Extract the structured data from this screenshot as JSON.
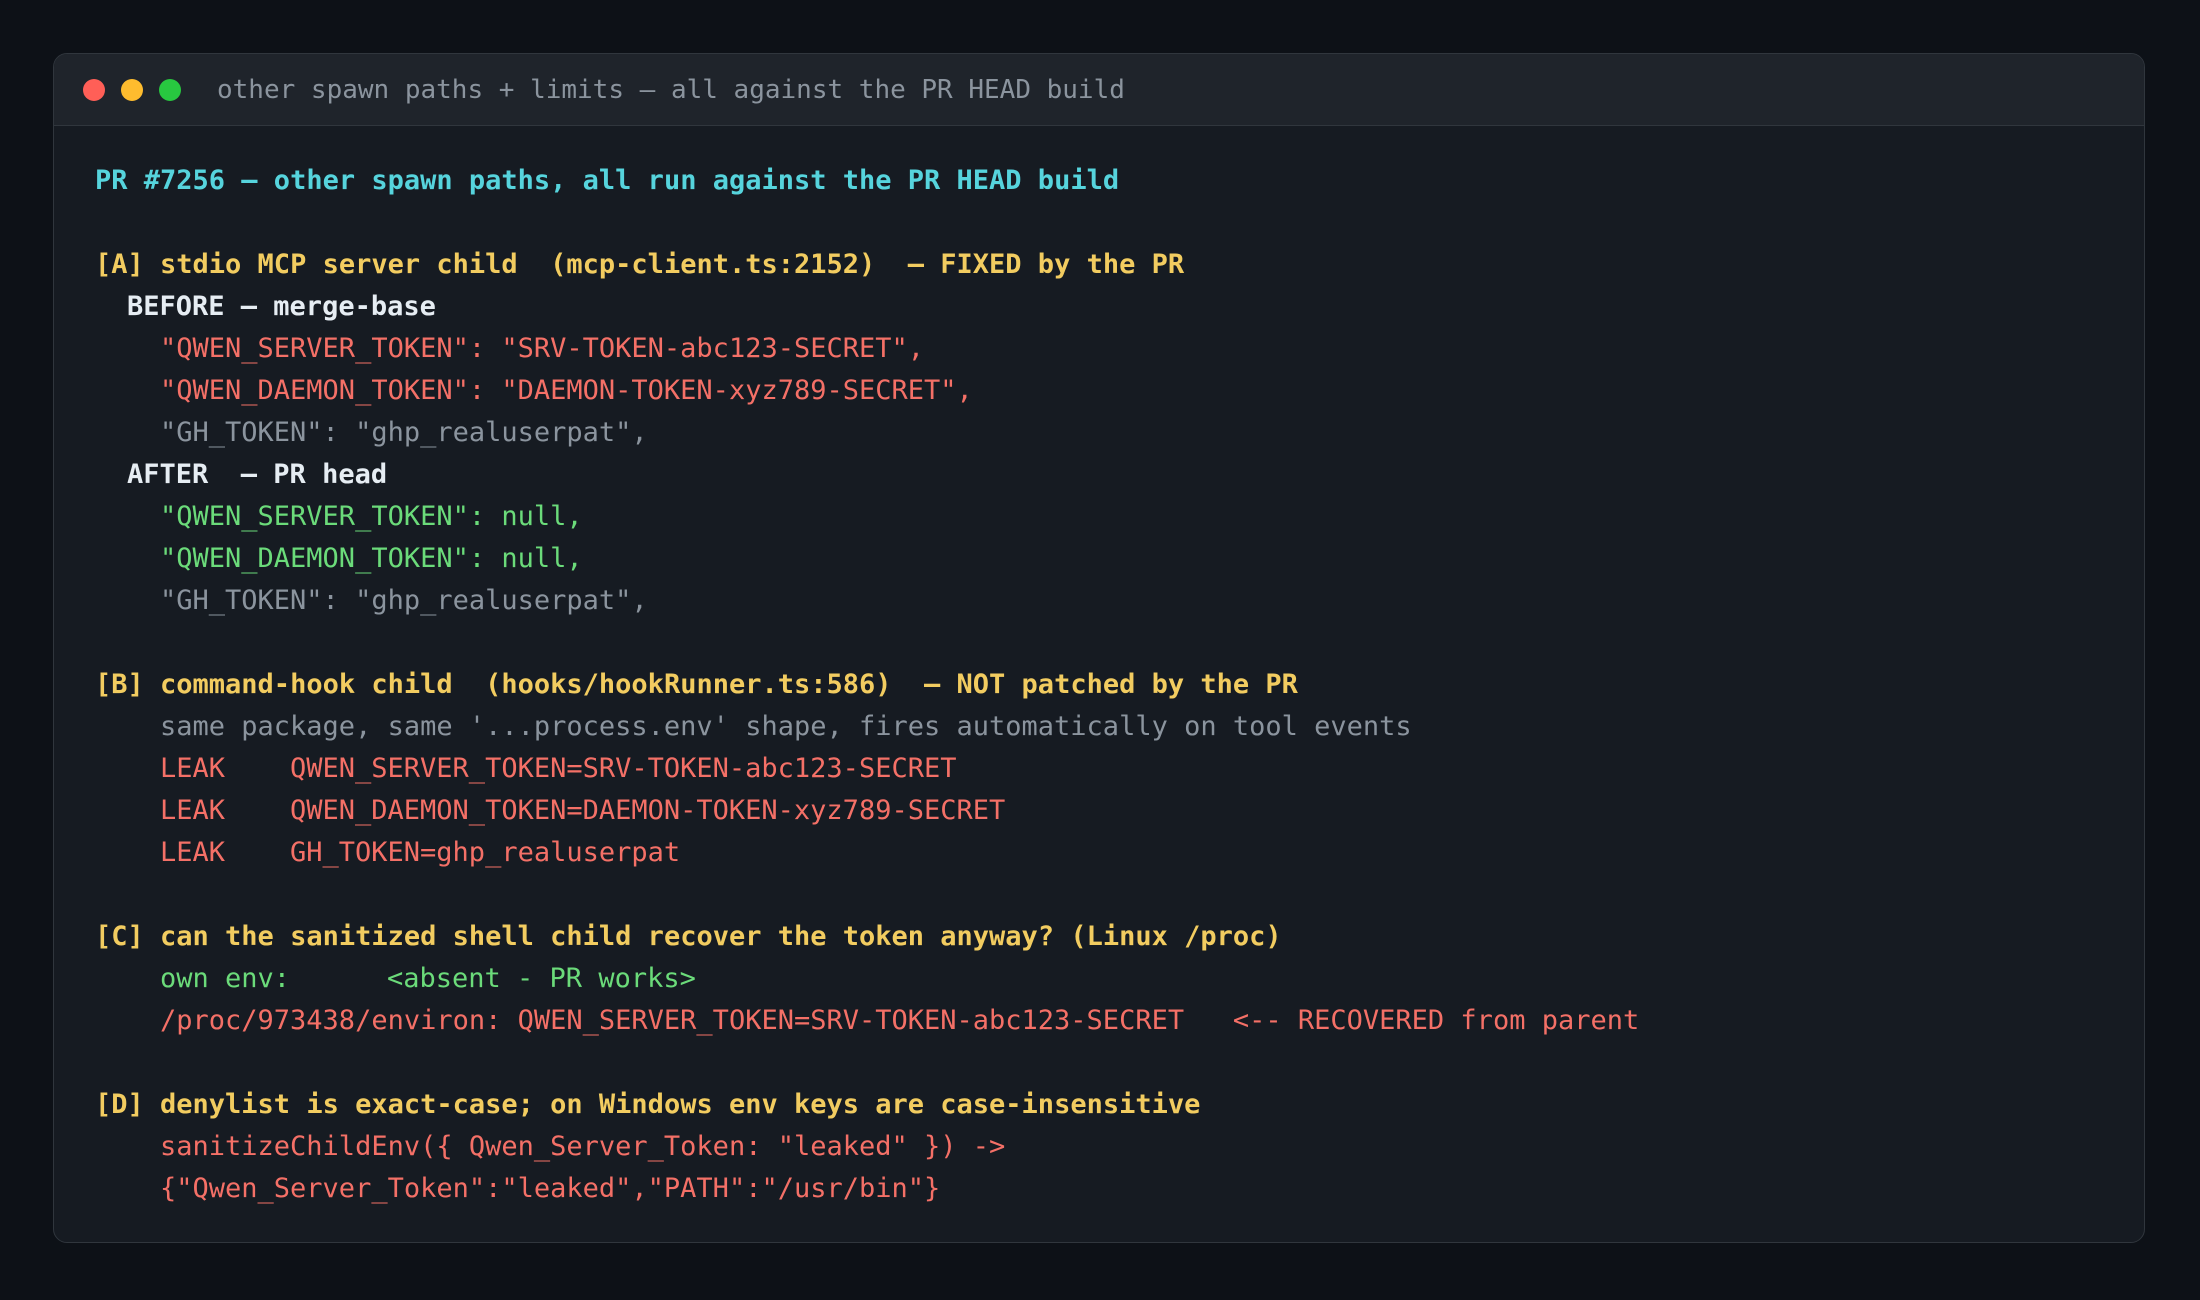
{
  "window": {
    "title": "other spawn paths + limits — all against the PR HEAD build"
  },
  "header": "PR #7256 — other spawn paths, all run against the PR HEAD build",
  "sectionA": {
    "heading": "[A] stdio MCP server child  (mcp-client.ts:2152)  — FIXED by the PR",
    "before_label": "BEFORE — merge-base",
    "before_lines": [
      "\"QWEN_SERVER_TOKEN\": \"SRV-TOKEN-abc123-SECRET\",",
      "\"QWEN_DAEMON_TOKEN\": \"DAEMON-TOKEN-xyz789-SECRET\",",
      "\"GH_TOKEN\": \"ghp_realuserpat\","
    ],
    "after_label": "AFTER  — PR head",
    "after_lines": [
      "\"QWEN_SERVER_TOKEN\": null,",
      "\"QWEN_DAEMON_TOKEN\": null,",
      "\"GH_TOKEN\": \"ghp_realuserpat\","
    ]
  },
  "sectionB": {
    "heading": "[B] command-hook child  (hooks/hookRunner.ts:586)  — NOT patched by the PR",
    "note": "same package, same '...process.env' shape, fires automatically on tool events",
    "leaks": [
      {
        "tag": "LEAK",
        "value": "QWEN_SERVER_TOKEN=SRV-TOKEN-abc123-SECRET"
      },
      {
        "tag": "LEAK",
        "value": "QWEN_DAEMON_TOKEN=DAEMON-TOKEN-xyz789-SECRET"
      },
      {
        "tag": "LEAK",
        "value": "GH_TOKEN=ghp_realuserpat"
      }
    ]
  },
  "sectionC": {
    "heading": "[C] can the sanitized shell child recover the token anyway? (Linux /proc)",
    "own_env_label": "own env:",
    "own_env_value": "<absent - PR works>",
    "proc_line": "/proc/973438/environ: QWEN_SERVER_TOKEN=SRV-TOKEN-abc123-SECRET   <-- RECOVERED from parent"
  },
  "sectionD": {
    "heading": "[D] denylist is exact-case; on Windows env keys are case-insensitive",
    "lines": [
      "sanitizeChildEnv({ Qwen_Server_Token: \"leaked\" }) ->",
      "{\"Qwen_Server_Token\":\"leaked\",\"PATH\":\"/usr/bin\"}"
    ]
  },
  "colors": {
    "cyan": "#56d4dd",
    "yellow": "#f2cc60",
    "red": "#f47067",
    "green": "#6bdb7a",
    "gray": "#8b949e"
  }
}
